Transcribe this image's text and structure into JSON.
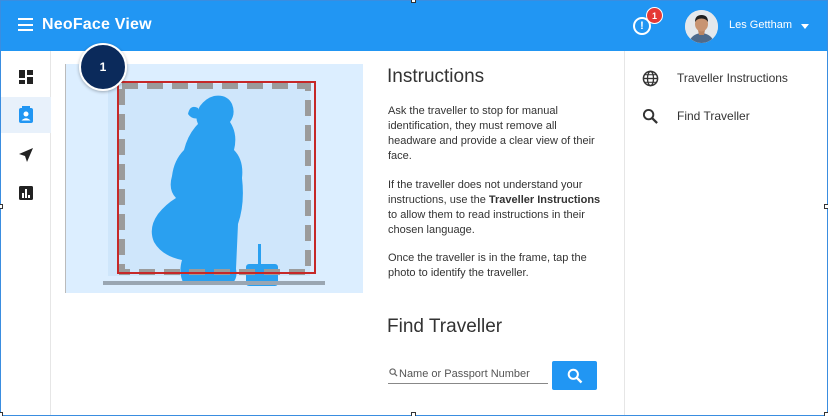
{
  "app": {
    "title": "NeoFace View"
  },
  "header": {
    "alert_count": "1",
    "alert_symbol": "!",
    "user_name": "Les Gettham"
  },
  "rail": {
    "items": [
      {
        "name": "dashboard",
        "icon": "dashboard-icon",
        "active": false
      },
      {
        "name": "traveller",
        "icon": "contact-card-icon",
        "active": true
      },
      {
        "name": "navigate",
        "icon": "navigation-arrow-icon",
        "active": false
      },
      {
        "name": "reports",
        "icon": "bar-chart-icon",
        "active": false
      }
    ]
  },
  "photo": {
    "step_number": "1"
  },
  "instructions": {
    "title": "Instructions",
    "paragraph1": "Ask the traveller to stop for manual identification, they must remove all headware and provide a clear view of their face.",
    "paragraph2_before": "If the traveller does not understand your instructions, use the ",
    "paragraph2_bold": "Traveller Instructions",
    "paragraph2_after": " to allow them to read instructions in their chosen language.",
    "paragraph3": "Once the traveller is in the frame, tap the photo to identify the traveller."
  },
  "find": {
    "title": "Find Traveller",
    "placeholder": "Name or Passport Number"
  },
  "right_panel": {
    "items": [
      {
        "label": "Traveller Instructions",
        "icon": "globe-icon"
      },
      {
        "label": "Find Traveller",
        "icon": "search-icon"
      }
    ]
  },
  "colors": {
    "app_bar": "#2196f3",
    "badge_red": "#e53935",
    "step_badge": "#0b2a5b",
    "face_frame": "#c62828",
    "silhouette": "#2aa0f0"
  }
}
